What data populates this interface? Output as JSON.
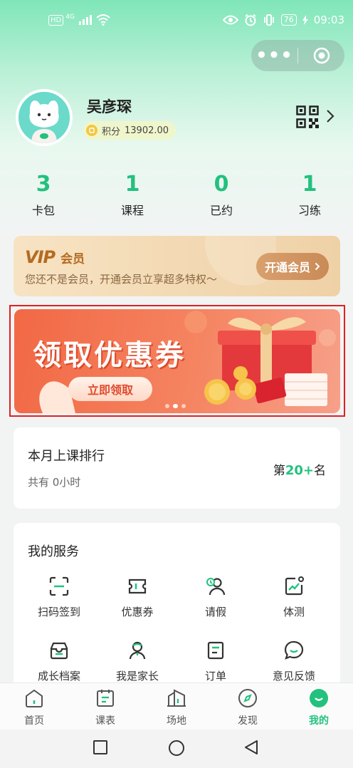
{
  "status_bar": {
    "network": "HD",
    "signal_label": "4G",
    "battery": "76",
    "time": "09:03"
  },
  "profile": {
    "name": "吴彦琛",
    "points_label": "积分",
    "points_value": "13902.00"
  },
  "stats": [
    {
      "value": "3",
      "label": "卡包"
    },
    {
      "value": "1",
      "label": "课程"
    },
    {
      "value": "0",
      "label": "已约"
    },
    {
      "value": "1",
      "label": "习练"
    }
  ],
  "vip": {
    "logo": "VIP",
    "title": "会员",
    "desc": "您还不是会员，开通会员立享超多特权～",
    "button": "开通会员"
  },
  "banner": {
    "title": "领取优惠券",
    "button": "立即领取",
    "slides_total": 3,
    "slide_active": 1
  },
  "ranking": {
    "title": "本月上课排行",
    "subtitle": "共有 0小时",
    "prefix": "第",
    "rank": "20+",
    "suffix": "名"
  },
  "services": {
    "title": "我的服务",
    "items": [
      {
        "label": "扫码签到",
        "icon": "scan-icon"
      },
      {
        "label": "优惠券",
        "icon": "coupon-icon"
      },
      {
        "label": "请假",
        "icon": "leave-icon"
      },
      {
        "label": "体测",
        "icon": "fitness-test-icon"
      },
      {
        "label": "成长档案",
        "icon": "growth-record-icon"
      },
      {
        "label": "我是家长",
        "icon": "parent-icon"
      },
      {
        "label": "订单",
        "icon": "order-icon"
      },
      {
        "label": "意见反馈",
        "icon": "feedback-icon"
      }
    ]
  },
  "tabs": [
    {
      "label": "首页",
      "icon": "home-icon"
    },
    {
      "label": "课表",
      "icon": "schedule-icon"
    },
    {
      "label": "场地",
      "icon": "venue-icon"
    },
    {
      "label": "发现",
      "icon": "discover-icon"
    },
    {
      "label": "我的",
      "icon": "profile-icon",
      "active": true
    }
  ],
  "colors": {
    "accent": "#22c17e",
    "vip_gold": "#b36b22",
    "banner_red": "#f26845"
  }
}
